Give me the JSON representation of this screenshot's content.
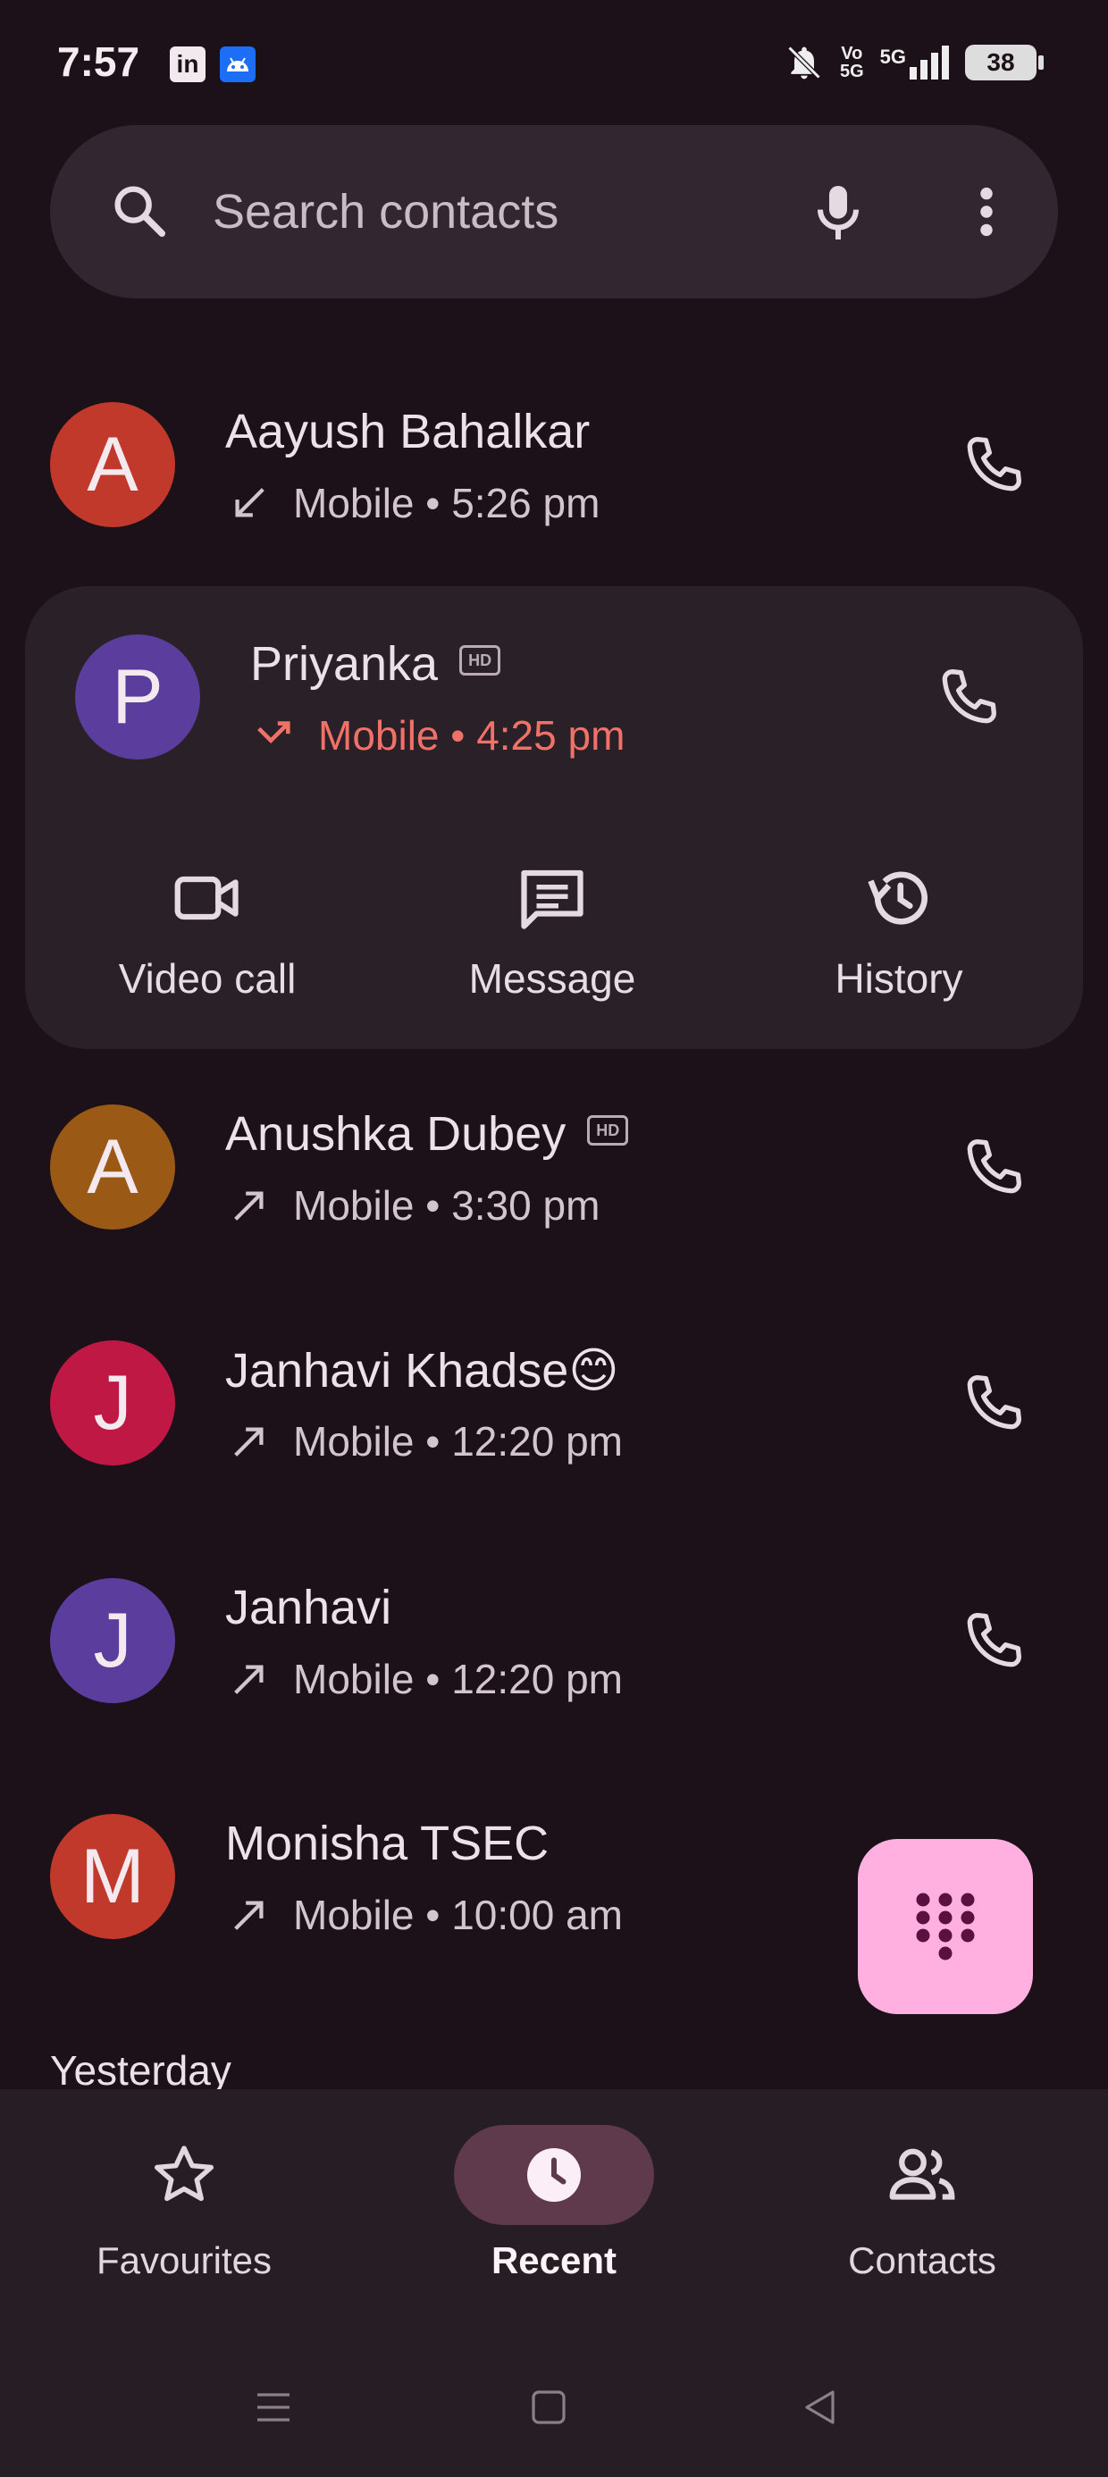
{
  "status_bar": {
    "time": "7:57",
    "app_icons": [
      "linkedin-icon",
      "android-icon"
    ],
    "linkedin_glyph": "in",
    "system_icons": [
      "bell-off-icon",
      "vo5g-icon",
      "5g-signal-icon"
    ],
    "vo_text": "Vo",
    "vo_sub": "5G",
    "net_label": "5G",
    "battery": "38"
  },
  "search": {
    "placeholder": "Search contacts"
  },
  "calls": [
    {
      "initial": "A",
      "name": "Aayush Bahalkar",
      "hd": false,
      "direction": "incoming",
      "type": "Mobile",
      "time": "5:26 pm",
      "avatar_color": "#c0392b"
    },
    {
      "initial": "P",
      "name": "Priyanka",
      "hd": true,
      "direction": "missed",
      "type": "Mobile",
      "time": "4:25 pm",
      "avatar_color": "#5b3d9e"
    },
    {
      "initial": "A",
      "name": "Anushka Dubey",
      "hd": true,
      "direction": "outgoing",
      "type": "Mobile",
      "time": "3:30 pm",
      "avatar_color": "#9a5a16"
    },
    {
      "initial": "J",
      "name": "Janhavi Khadse😊",
      "hd": false,
      "direction": "outgoing",
      "type": "Mobile",
      "time": "12:20 pm",
      "avatar_color": "#c01845"
    },
    {
      "initial": "J",
      "name": "Janhavi",
      "hd": false,
      "direction": "outgoing",
      "type": "Mobile",
      "time": "12:20 pm",
      "avatar_color": "#5b3d9e"
    },
    {
      "initial": "M",
      "name": "Monisha TSEC",
      "hd": false,
      "direction": "outgoing",
      "type": "Mobile",
      "time": "10:00 am",
      "avatar_color": "#c0392b"
    }
  ],
  "hd_badge": "HD",
  "separator": "•",
  "expanded_actions": [
    "Video call",
    "Message",
    "History"
  ],
  "section_header": "Yesterday",
  "bottom_nav": {
    "items": [
      "Favourites",
      "Recent",
      "Contacts"
    ],
    "active": "Recent"
  },
  "colors": {
    "background": "#1c1118",
    "missed": "#f07167",
    "fab": "#ffb0e0",
    "active_pill": "#5e3a4c"
  }
}
